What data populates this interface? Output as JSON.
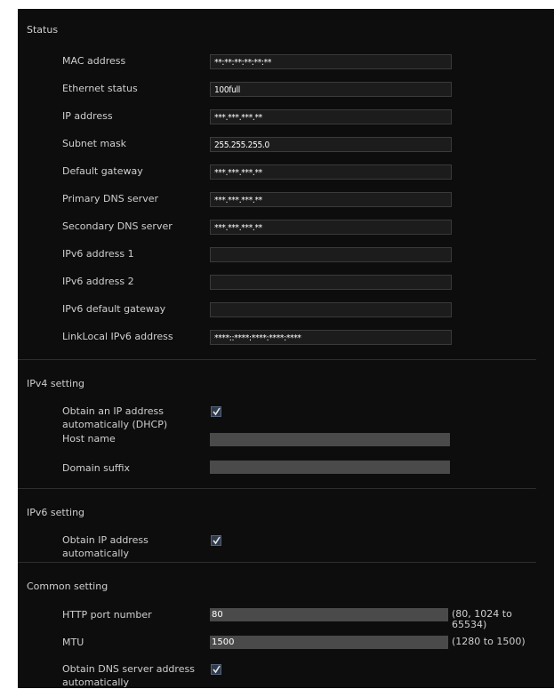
{
  "status": {
    "title": "Status",
    "rows": [
      {
        "label": "MAC address",
        "value": "**:**:**:**:**:**"
      },
      {
        "label": "Ethernet status",
        "value": "100full"
      },
      {
        "label": "IP address",
        "value": "***.***.***.**"
      },
      {
        "label": "Subnet mask",
        "value": "255.255.255.0"
      },
      {
        "label": "Default gateway",
        "value": "***.***.***.**"
      },
      {
        "label": "Primary DNS server",
        "value": "***.***.***.**"
      },
      {
        "label": "Secondary DNS server",
        "value": "***.***.***.**"
      },
      {
        "label": "IPv6 address 1",
        "value": ""
      },
      {
        "label": "IPv6 address 2",
        "value": ""
      },
      {
        "label": "IPv6 default gateway",
        "value": ""
      },
      {
        "label": "LinkLocal IPv6 address",
        "value": "****::****:****:****:****"
      }
    ]
  },
  "ipv4": {
    "title": "IPv4 setting",
    "dhcp_label_1": "Obtain an IP address",
    "dhcp_label_2": "automatically (DHCP)",
    "dhcp_checked": true,
    "host_name_label": "Host name",
    "host_name_value": "",
    "domain_suffix_label": "Domain suffix",
    "domain_suffix_value": ""
  },
  "ipv6": {
    "title": "IPv6 setting",
    "auto_label_1": "Obtain IP address",
    "auto_label_2": "automatically",
    "auto_checked": true
  },
  "common": {
    "title": "Common setting",
    "http_port_label": "HTTP port number",
    "http_port_value": "80",
    "http_port_range_1": "(80, 1024 to",
    "http_port_range_2": "65534)",
    "mtu_label": "MTU",
    "mtu_value": "1500",
    "mtu_range": "(1280 to 1500)",
    "dns_auto_label_1": "Obtain DNS server address",
    "dns_auto_label_2": "automatically",
    "dns_auto_checked": true
  },
  "colors": {
    "panel_bg": "#0d0d0d",
    "text": "#cfcfcf",
    "field_bg": "#1c1c1c",
    "input_bg": "#4a4a4a",
    "check_bg": "#2f3b4d"
  }
}
